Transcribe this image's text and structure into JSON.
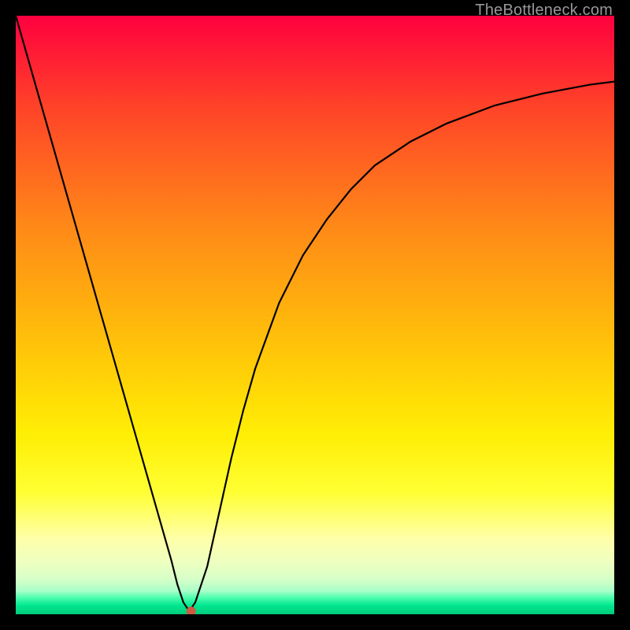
{
  "watermark": "TheBottleneck.com",
  "chart_data": {
    "type": "line",
    "title": "",
    "xlabel": "",
    "ylabel": "",
    "xlim": [
      0,
      100
    ],
    "ylim": [
      0,
      100
    ],
    "grid": false,
    "series": [
      {
        "name": "bottleneck-curve",
        "x": [
          0,
          2,
          4,
          6,
          8,
          10,
          12,
          14,
          16,
          18,
          20,
          22,
          24,
          26,
          27,
          28,
          29,
          30,
          32,
          34,
          36,
          38,
          40,
          44,
          48,
          52,
          56,
          60,
          66,
          72,
          80,
          88,
          96,
          100
        ],
        "values": [
          100,
          93,
          86,
          79,
          72,
          65,
          58,
          51,
          44,
          37,
          30,
          23,
          16,
          9,
          5,
          2,
          0.5,
          2,
          8,
          17,
          26,
          34,
          41,
          52,
          60,
          66,
          71,
          75,
          79,
          82,
          85,
          87,
          88.5,
          89
        ]
      }
    ],
    "marker": {
      "x": 29.3,
      "y": 0.5,
      "color": "#d05a40"
    },
    "background_gradient_top_to_bottom": [
      "#ff003f",
      "#ff8818",
      "#ffff33",
      "#00cc7a"
    ]
  }
}
